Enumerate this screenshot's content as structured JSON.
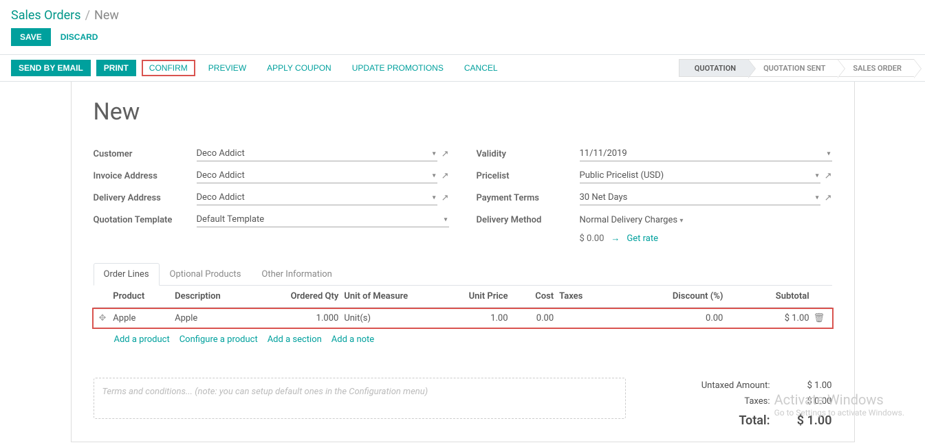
{
  "breadcrumb": {
    "parent": "Sales Orders",
    "sep": "/",
    "current": "New"
  },
  "header_actions": {
    "save": "SAVE",
    "discard": "DISCARD"
  },
  "toolbar": {
    "send_email": "SEND BY EMAIL",
    "print": "PRINT",
    "confirm": "CONFIRM",
    "preview": "PREVIEW",
    "apply_coupon": "APPLY COUPON",
    "update_promotions": "UPDATE PROMOTIONS",
    "cancel": "CANCEL"
  },
  "status": {
    "quotation": "QUOTATION",
    "quotation_sent": "QUOTATION SENT",
    "sales_order": "SALES ORDER"
  },
  "title": "New",
  "fields": {
    "customer_label": "Customer",
    "customer_value": "Deco Addict",
    "invoice_addr_label": "Invoice Address",
    "invoice_addr_value": "Deco Addict",
    "delivery_addr_label": "Delivery Address",
    "delivery_addr_value": "Deco Addict",
    "quot_tpl_label": "Quotation Template",
    "quot_tpl_value": "Default Template",
    "validity_label": "Validity",
    "validity_value": "11/11/2019",
    "pricelist_label": "Pricelist",
    "pricelist_value": "Public Pricelist (USD)",
    "payterms_label": "Payment Terms",
    "payterms_value": "30 Net Days",
    "delivery_method_label": "Delivery Method",
    "delivery_method_value": "Normal Delivery Charges",
    "delivery_cost": "$ 0.00",
    "get_rate": "Get rate"
  },
  "tabs": {
    "order_lines": "Order Lines",
    "optional_products": "Optional Products",
    "other_info": "Other Information"
  },
  "ol_headers": {
    "product": "Product",
    "description": "Description",
    "qty": "Ordered Qty",
    "uom": "Unit of Measure",
    "unit_price": "Unit Price",
    "cost": "Cost",
    "taxes": "Taxes",
    "discount": "Discount (%)",
    "subtotal": "Subtotal"
  },
  "lines": [
    {
      "product": "Apple",
      "description": "Apple",
      "qty": "1.000",
      "uom": "Unit(s)",
      "unit_price": "1.00",
      "cost": "0.00",
      "taxes": "",
      "discount": "0.00",
      "subtotal": "$ 1.00"
    }
  ],
  "ol_actions": {
    "add_product": "Add a product",
    "configure_product": "Configure a product",
    "add_section": "Add a section",
    "add_note": "Add a note"
  },
  "terms_placeholder": "Terms and conditions... (note: you can setup default ones in the Configuration menu)",
  "totals": {
    "untaxed_label": "Untaxed Amount:",
    "untaxed_value": "$ 1.00",
    "taxes_label": "Taxes:",
    "taxes_value": "$ 0.00",
    "total_label": "Total:",
    "total_value": "$ 1.00"
  },
  "watermark": {
    "title": "Activate Windows",
    "sub": "Go to Settings to activate Windows."
  }
}
